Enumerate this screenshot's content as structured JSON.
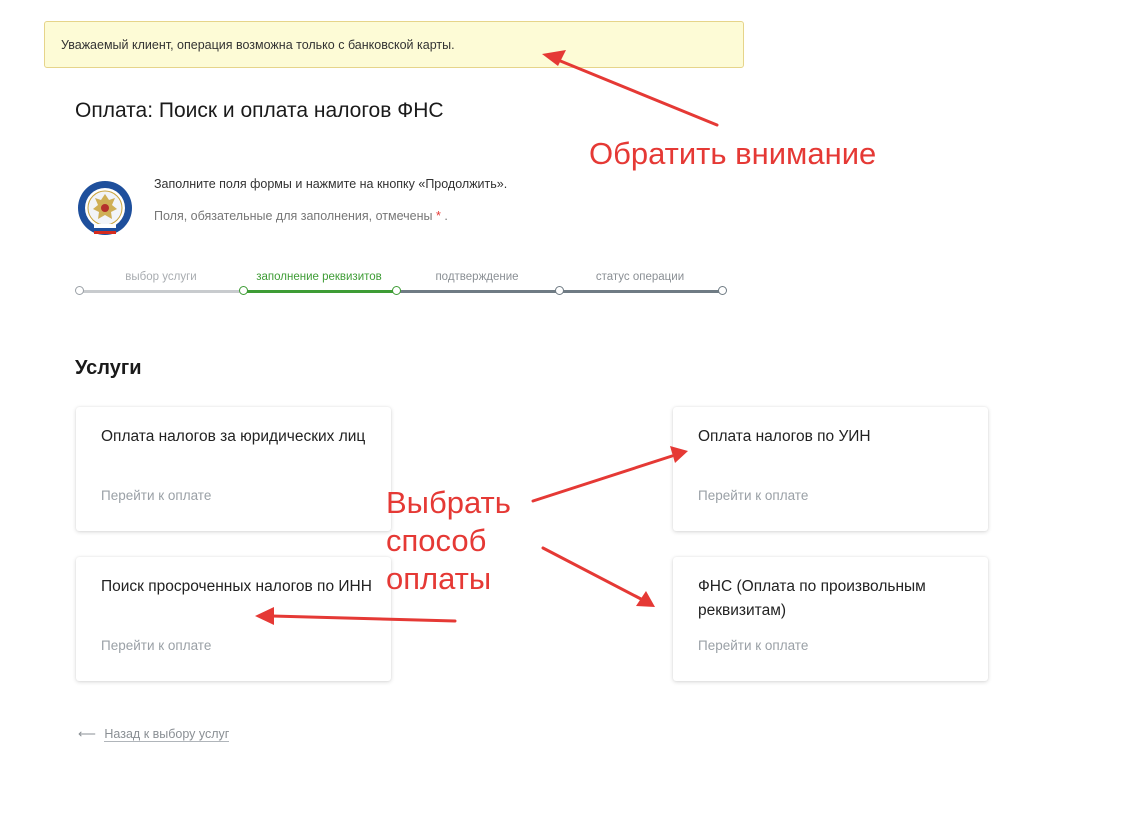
{
  "notice": {
    "text": "Уважаемый клиент, операция возможна только с банковской карты."
  },
  "page": {
    "title": "Оплата: Поиск и оплата налогов ФНС"
  },
  "hint": {
    "line1": "Заполните поля формы и нажмите на кнопку «Продолжить».",
    "line2": "Поля, обязательные для заполнения, отмечены",
    "star": "*",
    "end": "."
  },
  "steps": [
    {
      "label": "выбор услуги",
      "state": "done"
    },
    {
      "label": "заполнение реквизитов",
      "state": "active"
    },
    {
      "label": "подтверждение",
      "state": "pending"
    },
    {
      "label": "статус операции",
      "state": "pending"
    }
  ],
  "services": {
    "title": "Услуги",
    "cards": [
      {
        "title": "Оплата налогов за юридических лиц",
        "link": "Перейти к оплате"
      },
      {
        "title": "Оплата налогов по УИН",
        "link": "Перейти к оплате"
      },
      {
        "title": "Поиск просроченных налогов по ИНН",
        "link": "Перейти к оплате"
      },
      {
        "title": "ФНС (Оплата по произвольным реквизитам)",
        "link": "Перейти к оплате"
      }
    ]
  },
  "back": {
    "arrow": "⟵",
    "label": "Назад к выбору услуг"
  },
  "annotations": {
    "attention": "Обратить внимание",
    "choose": [
      "Выбрать",
      "способ",
      "оплаты"
    ]
  },
  "colors": {
    "annotation": "#e53935",
    "step_active": "#3e9c35",
    "step_done": "#c8cbce",
    "step_pending": "#6f7b84",
    "notice_bg": "#fdfbd6"
  },
  "icons": {
    "logo": "fns-emblem-icon",
    "back": "arrow-left-icon"
  }
}
